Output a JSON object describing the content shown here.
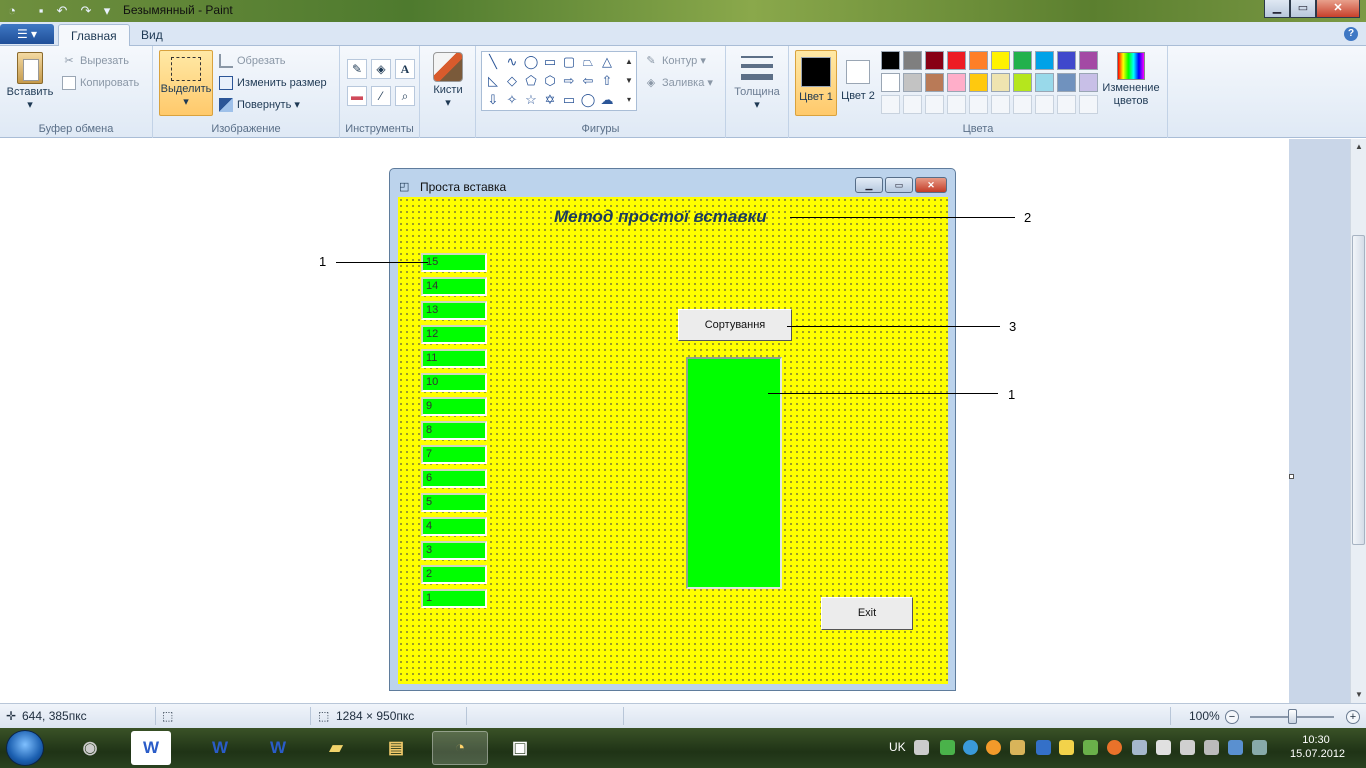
{
  "window": {
    "title": "Безымянный - Paint"
  },
  "tabs": [
    {
      "label": "Главная"
    },
    {
      "label": "Вид"
    }
  ],
  "ribbon": {
    "clipboard": {
      "paste": "Вставить",
      "cut": "Вырезать",
      "copy": "Копировать",
      "group": "Буфер обмена"
    },
    "image": {
      "select": "Выделить",
      "crop": "Обрезать",
      "resize": "Изменить размер",
      "rotate": "Повернуть",
      "group": "Изображение"
    },
    "tools": {
      "group": "Инструменты"
    },
    "brushes": {
      "label": "Кисти"
    },
    "shapes": {
      "outline": "Контур",
      "fill": "Заливка",
      "group": "Фигуры"
    },
    "size": {
      "label": "Толщина"
    },
    "colors": {
      "color1_label": "Цвет 1",
      "color2_label": "Цвет 2",
      "edit_label": "Изменение цветов",
      "group": "Цвета",
      "color1": "#000000",
      "color2": "#ffffff",
      "palette_row1": [
        "#000000",
        "#7f7f7f",
        "#880015",
        "#ed1c24",
        "#ff7f27",
        "#fff200",
        "#22b14c",
        "#00a2e8",
        "#3f48cc",
        "#a349a4"
      ],
      "palette_row2": [
        "#ffffff",
        "#c3c3c3",
        "#b97a57",
        "#ffaec9",
        "#ffc90e",
        "#efe4b0",
        "#b5e61d",
        "#99d9ea",
        "#7092be",
        "#c8bfe7"
      ]
    }
  },
  "vbform": {
    "title": "Проста вставка",
    "heading": "Метод простої вставки",
    "cells": [
      "15",
      "14",
      "13",
      "12",
      "11",
      "10",
      "9",
      "8",
      "7",
      "6",
      "5",
      "4",
      "3",
      "2",
      "1"
    ],
    "sort_button": "Сортування",
    "exit_button": "Exit",
    "form_color": "#ffff00",
    "cell_color": "#00ff00"
  },
  "callouts": {
    "c1_left": "1",
    "c2": "2",
    "c3": "3",
    "c1_right": "1"
  },
  "status": {
    "cursor_pos": "644, 385пкс",
    "image_size": "1284 × 950пкс",
    "zoom": "100%"
  },
  "taskbar": {
    "lang": "UK",
    "time": "10:30",
    "date": "15.07.2012"
  }
}
